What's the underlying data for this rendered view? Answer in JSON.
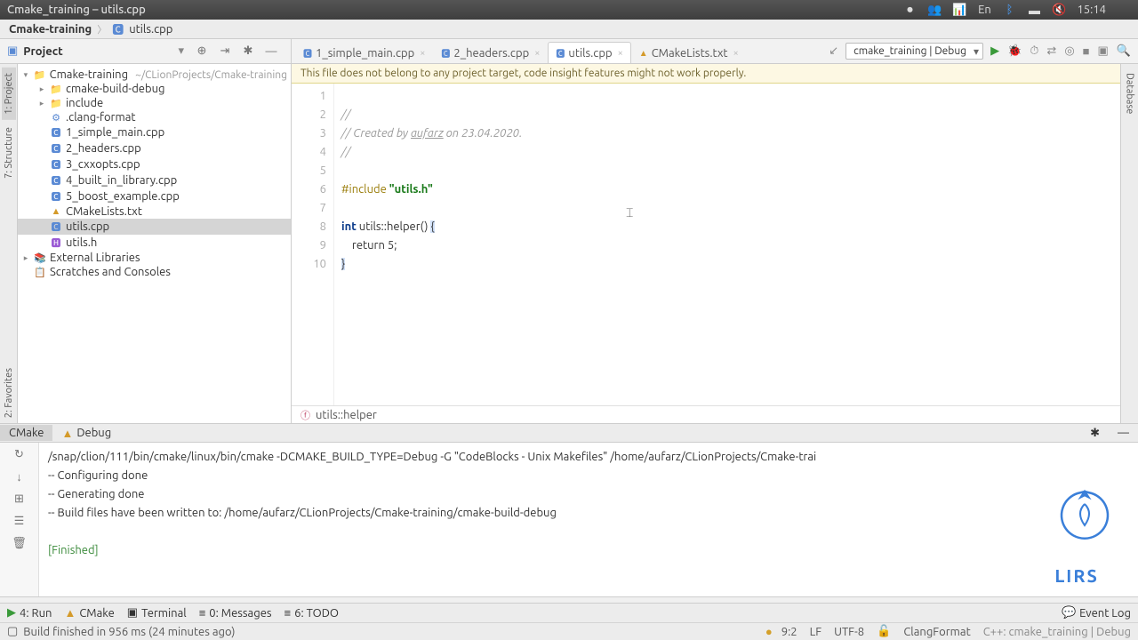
{
  "titlebar": {
    "title": "Cmake_training – utils.cpp",
    "time": "15:14",
    "lang": "En"
  },
  "breadcrumbs": {
    "root": "Cmake-training",
    "file": "utils.cpp"
  },
  "project_header": "Project",
  "build_config": "cmake_training | Debug",
  "tabs": [
    {
      "icon": "🅲",
      "label": "1_simple_main.cpp"
    },
    {
      "icon": "🅲",
      "label": "2_headers.cpp"
    },
    {
      "icon": "🅲",
      "label": "utils.cpp",
      "active": true
    },
    {
      "icon": "▲",
      "label": "CMakeLists.txt"
    }
  ],
  "tree": [
    {
      "depth": 0,
      "arrow": "▾",
      "icon": "📁",
      "label": "Cmake-training",
      "hint": "~/CLionProjects/Cmake-training"
    },
    {
      "depth": 1,
      "arrow": "▸",
      "icon": "📁",
      "label": "cmake-build-debug",
      "folder_color": "#d4a94a"
    },
    {
      "depth": 1,
      "arrow": "▸",
      "icon": "📁",
      "label": "include"
    },
    {
      "depth": 1,
      "arrow": "",
      "icon": "⚙",
      "label": ".clang-format"
    },
    {
      "depth": 1,
      "arrow": "",
      "icon": "🅲",
      "label": "1_simple_main.cpp"
    },
    {
      "depth": 1,
      "arrow": "",
      "icon": "🅲",
      "label": "2_headers.cpp"
    },
    {
      "depth": 1,
      "arrow": "",
      "icon": "🅲",
      "label": "3_cxxopts.cpp"
    },
    {
      "depth": 1,
      "arrow": "",
      "icon": "🅲",
      "label": "4_built_in_library.cpp"
    },
    {
      "depth": 1,
      "arrow": "",
      "icon": "🅲",
      "label": "5_boost_example.cpp"
    },
    {
      "depth": 1,
      "arrow": "",
      "icon": "▲",
      "label": "CMakeLists.txt"
    },
    {
      "depth": 1,
      "arrow": "",
      "icon": "🅲",
      "label": "utils.cpp",
      "selected": true
    },
    {
      "depth": 1,
      "arrow": "",
      "icon": "🅷",
      "label": "utils.h"
    },
    {
      "depth": 0,
      "arrow": "▸",
      "icon": "📚",
      "label": "External Libraries"
    },
    {
      "depth": 0,
      "arrow": "",
      "icon": "📋",
      "label": "Scratches and Consoles"
    }
  ],
  "warning": "This file does not belong to any project target, code insight features might not work properly.",
  "code": {
    "lines": [
      "1",
      "2",
      "3",
      "4",
      "5",
      "6",
      "7",
      "8",
      "9",
      "10"
    ],
    "l1": "//",
    "l2a": "// Created by ",
    "l2b": "aufarz",
    "l2c": " on 23.04.2020.",
    "l3": "//",
    "l5_pre": "#include ",
    "l5_str": "\"utils.h\"",
    "l7_kw": "int",
    "l7_rest": " utils::helper() ",
    "l8": "    return 5;",
    "l9": "}"
  },
  "editor_crumb": "utils::helper",
  "side_tabs": {
    "project": "1: Project",
    "structure": "7: Structure",
    "fav": "2: Favorites",
    "db": "Database"
  },
  "bottom_tabs": {
    "cmake": "CMake",
    "debug": "Debug"
  },
  "cmake_output": {
    "cmd": "/snap/clion/111/bin/cmake/linux/bin/cmake -DCMAKE_BUILD_TYPE=Debug -G \"CodeBlocks - Unix Makefiles\" /home/aufarz/CLionProjects/Cmake-trai",
    "l2": "-- Configuring done",
    "l3": "-- Generating done",
    "l4": "-- Build files have been written to: /home/aufarz/CLionProjects/Cmake-training/cmake-build-debug",
    "fin": "[Finished]"
  },
  "lirs": "LIRS",
  "status": {
    "run": "4: Run",
    "cmake": "CMake",
    "terminal": "Terminal",
    "messages": "0: Messages",
    "todo": "6: TODO",
    "eventlog": "Event Log",
    "pos": "9:2",
    "lf": "LF",
    "enc": "UTF-8",
    "fmt": "ClangFormat",
    "ctx": "C++: cmake_training | Debug"
  },
  "footer": "Build finished in 956 ms (24 minutes ago)"
}
